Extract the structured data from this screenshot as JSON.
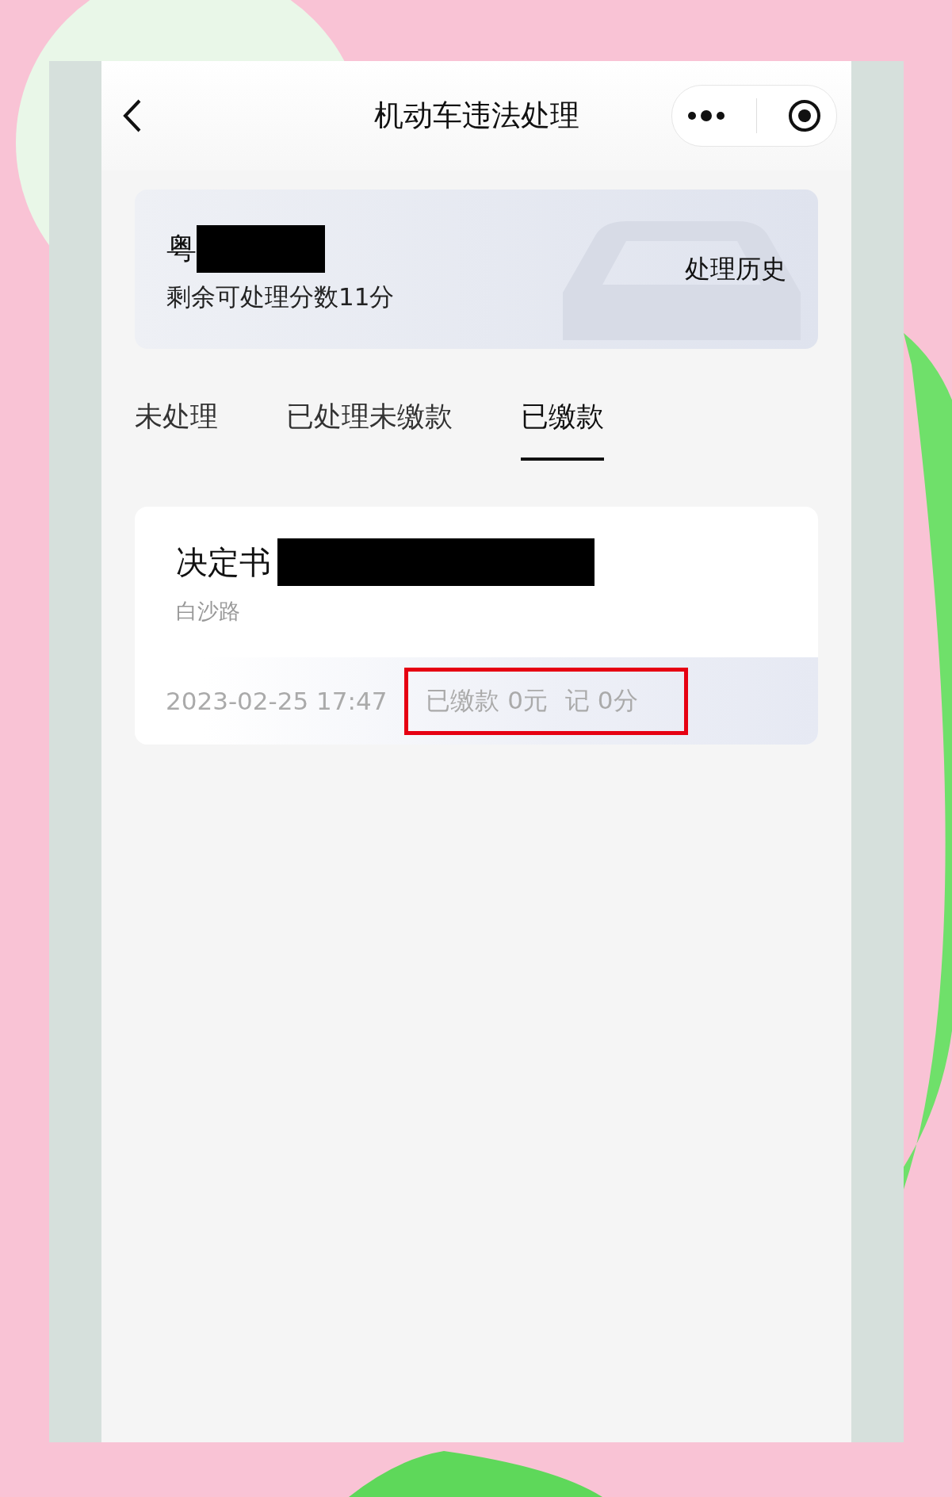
{
  "header": {
    "title": "机动车违法处理"
  },
  "vehicle": {
    "plate_prefix": "粤",
    "points_text": "剩余可处理分数11分",
    "history_link": "处理历史"
  },
  "tabs": [
    {
      "label": "未处理",
      "selected": false
    },
    {
      "label": "已处理未缴款",
      "selected": false
    },
    {
      "label": "已缴款",
      "selected": true
    }
  ],
  "records": [
    {
      "title": "决定书",
      "location": "白沙路",
      "time": "2023-02-25 17:47",
      "payment": "已缴款 0元",
      "points": "记 0分",
      "highlighted": true
    }
  ]
}
